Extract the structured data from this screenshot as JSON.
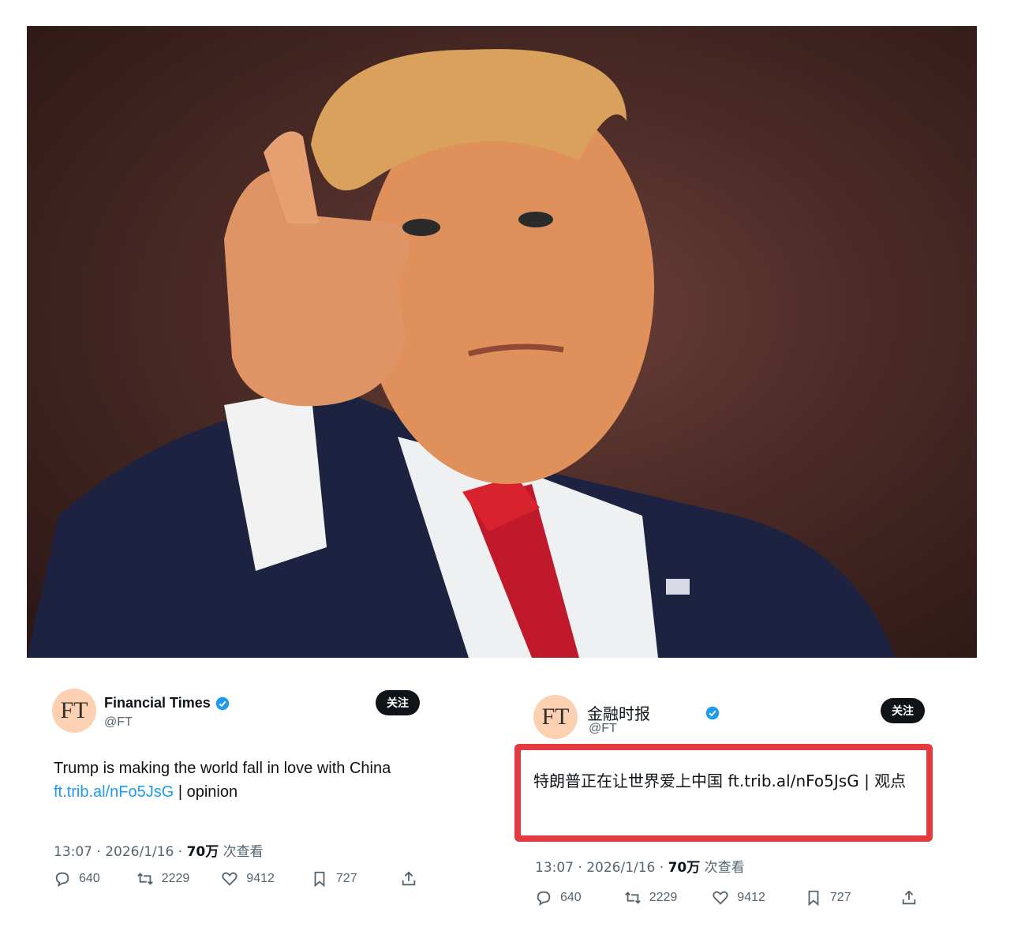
{
  "photo": {
    "alt_label": "photo"
  },
  "tweet_en": {
    "avatar_text": "FT",
    "name": "Financial Times",
    "handle": "@FT",
    "follow_label": "关注",
    "text_main": "Trump is making the world fall in love with China",
    "link": "ft.trib.al/nFo5JsG",
    "text_tail": " | opinion",
    "time": "13:07 · 2026/1/16 · ",
    "views": "70万",
    "views_suffix": " 次查看",
    "replies": "640",
    "retweets": "2229",
    "likes": "9412",
    "bookmarks": "727"
  },
  "tweet_zh": {
    "avatar_text": "FT",
    "name": "金融时报",
    "handle": "@FT",
    "follow_label": "关注",
    "text": "特朗普正在让世界爱上中国 ft.trib.al/nFo5JsG | 观点",
    "time": "13:07 · 2026/1/16 · ",
    "views": "70万",
    "views_suffix": " 次查看",
    "replies": "640",
    "retweets": "2229",
    "likes": "9412",
    "bookmarks": "727"
  },
  "colors": {
    "verified": "#1d9bf0",
    "highlight": "#e23a3e",
    "link": "#1d9bf0"
  }
}
